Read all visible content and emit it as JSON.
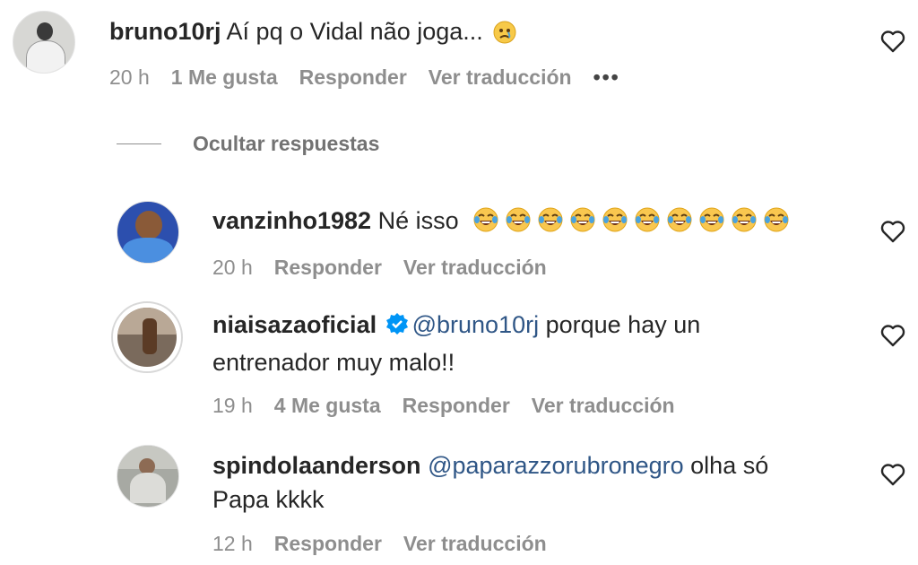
{
  "comment_main": {
    "username": "bruno10rj",
    "text": "Aí pq o Vidal não joga...",
    "emoji": "sad-face",
    "time": "20 h",
    "likes": "1 Me gusta",
    "reply": "Responder",
    "translate": "Ver traducción",
    "more": "•••"
  },
  "hide_replies": "Ocultar respuestas",
  "replies": [
    {
      "username": "vanzinho1982",
      "text": "Né isso",
      "emoji": "tears-of-joy",
      "emoji_count": 10,
      "time": "20 h",
      "reply": "Responder",
      "translate": "Ver traducción"
    },
    {
      "username": "niaisazaoficial",
      "verified": true,
      "mention": "@bruno10rj",
      "text_line1": " porque hay un",
      "text_line2": "entrenador muy malo!!",
      "time": "19 h",
      "likes": "4 Me gusta",
      "reply": "Responder",
      "translate": "Ver traducción"
    },
    {
      "username": "spindolaanderson",
      "mention": "@paparazzorubronegro",
      "text_line1": " olha só",
      "text_line2": "Papa kkkk",
      "time": "12 h",
      "reply": "Responder",
      "translate": "Ver traducción"
    }
  ],
  "colors": {
    "text": "#262626",
    "meta": "#8e8e8e",
    "mention": "#2f5686",
    "verified": "#0095f6"
  }
}
